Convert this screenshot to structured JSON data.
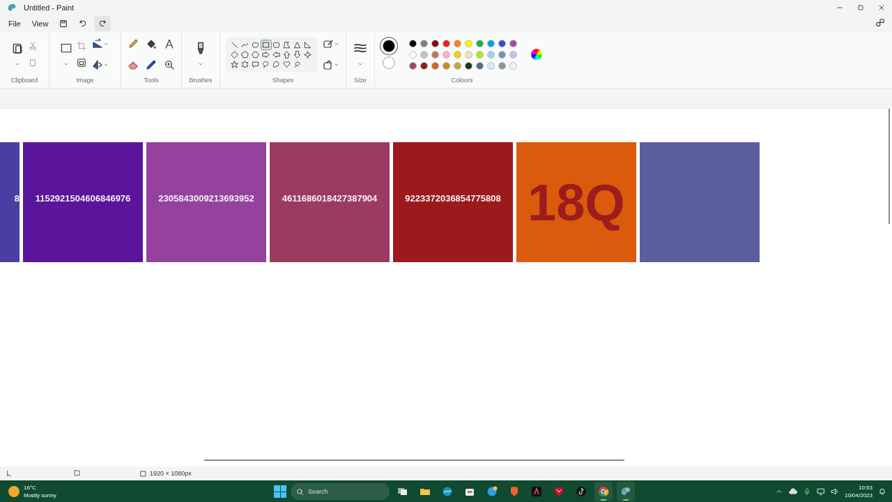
{
  "window": {
    "title": "Untitled - Paint"
  },
  "menu": [
    "File",
    "View"
  ],
  "ribbon_groups": [
    "Clipboard",
    "Image",
    "Tools",
    "Brushes",
    "Shapes",
    "Size",
    "Colours"
  ],
  "shapes": [
    {
      "selected": false
    },
    {
      "selected": false
    },
    {
      "selected": false
    },
    {
      "selected": true
    },
    {
      "selected": false
    },
    {
      "selected": false
    },
    {
      "selected": false
    },
    {
      "selected": false
    },
    {
      "selected": false
    },
    {
      "selected": false
    },
    {
      "selected": false
    },
    {
      "selected": false
    },
    {
      "selected": false
    },
    {
      "selected": false
    },
    {
      "selected": false
    },
    {
      "selected": false
    },
    {
      "selected": false
    },
    {
      "selected": false
    },
    {
      "selected": false
    },
    {
      "selected": false
    },
    {
      "selected": false
    },
    {
      "selected": false
    },
    {
      "selected": false
    }
  ],
  "primary_colour": {
    "color": "#000000"
  },
  "secondary_colour": {
    "color": "#ffffff"
  },
  "colours": [
    {
      "color": "#000000"
    },
    {
      "color": "#7f7f7f"
    },
    {
      "color": "#880015"
    },
    {
      "color": "#ed1c24"
    },
    {
      "color": "#ff7f27"
    },
    {
      "color": "#fff200"
    },
    {
      "color": "#22b14c"
    },
    {
      "color": "#00a2e8"
    },
    {
      "color": "#3f48cc"
    },
    {
      "color": "#a349a4"
    },
    {
      "color": "#ffffff"
    },
    {
      "color": "#c3c3c3"
    },
    {
      "color": "#b97a57"
    },
    {
      "color": "#ffaec9"
    },
    {
      "color": "#ffc90e"
    },
    {
      "color": "#efe4b0"
    },
    {
      "color": "#b5e61d"
    },
    {
      "color": "#99d9ea"
    },
    {
      "color": "#7092be"
    },
    {
      "color": "#c8bfe7"
    },
    {
      "color": "#a3456c"
    },
    {
      "color": "#8e1c1c"
    },
    {
      "color": "#d4631e"
    },
    {
      "color": "#c98c20"
    },
    {
      "color": "#c9a63c"
    },
    {
      "color": "#0d3f14"
    },
    {
      "color": "#5c6b7d"
    },
    {
      "color": "#cdeef4"
    },
    {
      "color": "#8a949e"
    },
    {
      "color": "#f3f3f3"
    }
  ],
  "tiles": [
    {
      "kind": "number",
      "color": "#4b3ea3",
      "text": "8"
    },
    {
      "kind": "number",
      "color": "#5a159b",
      "text": "1152921504606846976"
    },
    {
      "kind": "number",
      "color": "#95429e",
      "text": "2305843009213693952"
    },
    {
      "kind": "number",
      "color": "#9b3b62",
      "text": "4611686018427387904"
    },
    {
      "kind": "number",
      "color": "#9c1a1b",
      "text": "9223372036854775808"
    },
    {
      "kind": "big",
      "color": "#dc5a0c",
      "text": "18Q"
    },
    {
      "kind": "blank",
      "color": "#5a5e9f"
    }
  ],
  "status_bar": {
    "canvas_size": "1920 × 1080px"
  },
  "taskbar": {
    "temperature": "16°C",
    "weather": "Mostly sunny",
    "search_placeholder": "Search",
    "apps": [
      {
        "kind": "taskview",
        "running": false
      },
      {
        "kind": "folder",
        "running": false
      },
      {
        "kind": "wave",
        "running": false
      },
      {
        "kind": "store",
        "running": false
      },
      {
        "kind": "help",
        "running": false
      },
      {
        "kind": "lion",
        "running": false
      },
      {
        "kind": "letter",
        "running": false
      },
      {
        "kind": "shield",
        "running": false
      },
      {
        "kind": "note",
        "running": false
      },
      {
        "kind": "chrome",
        "running": true
      },
      {
        "kind": "paint",
        "running": true
      }
    ],
    "time": "10:53",
    "date": "10/04/2023"
  }
}
